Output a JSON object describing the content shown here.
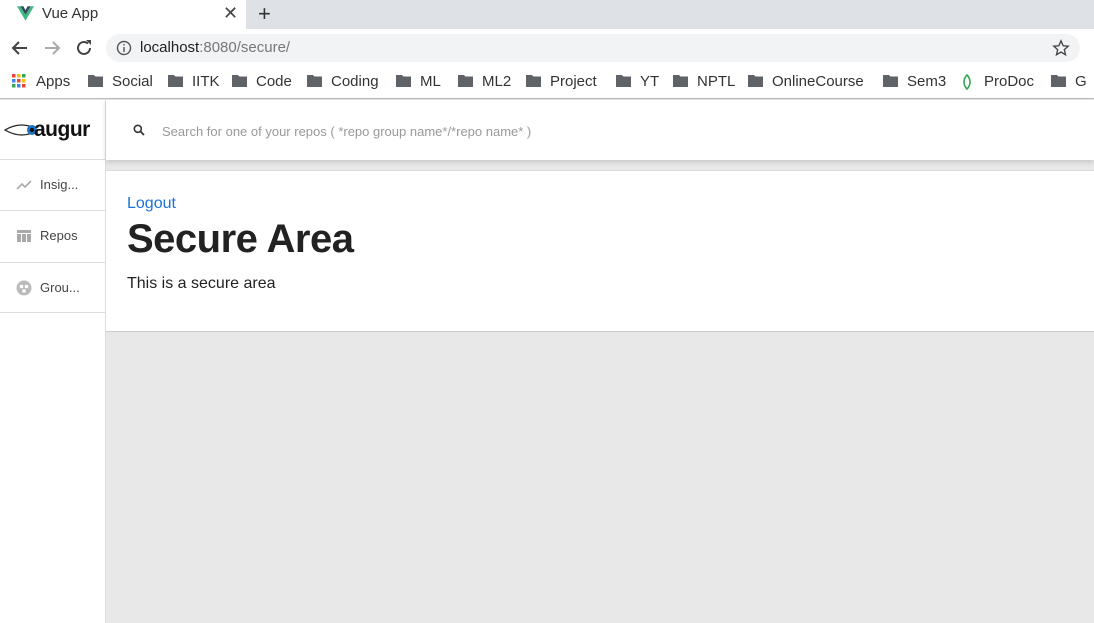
{
  "browser": {
    "tab": {
      "title": "Vue App",
      "close": "✕"
    },
    "new_tab": "+",
    "url_host": "localhost",
    "url_path": ":8080/secure/",
    "bookmarks": [
      "Apps",
      "Social",
      "IITK",
      "Code",
      "Coding",
      "ML",
      "ML2",
      "Project",
      "YT",
      "NPTL",
      "OnlineCourse",
      "Sem3",
      "ProDoc",
      "G"
    ]
  },
  "sidebar": {
    "logo": "augur",
    "items": [
      {
        "label": "Insig...",
        "icon": "trending-icon"
      },
      {
        "label": "Repos",
        "icon": "table-icon"
      },
      {
        "label": "Grou...",
        "icon": "group-icon"
      }
    ]
  },
  "search": {
    "placeholder": "Search for one of your repos ( *repo group name*/*repo name* )"
  },
  "main": {
    "logout": "Logout",
    "title": "Secure Area",
    "body": "This is a secure area"
  },
  "colors": {
    "link": "#1a73d9",
    "vue_green": "#41b883"
  }
}
